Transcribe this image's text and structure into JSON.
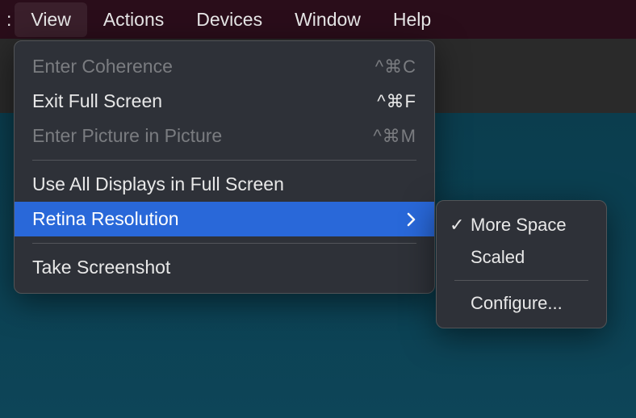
{
  "menubar": {
    "items": [
      {
        "label": "View",
        "selected": true
      },
      {
        "label": "Actions",
        "selected": false
      },
      {
        "label": "Devices",
        "selected": false
      },
      {
        "label": "Window",
        "selected": false
      },
      {
        "label": "Help",
        "selected": false
      }
    ]
  },
  "view_menu": {
    "items": [
      {
        "label": "Enter Coherence",
        "shortcut": "^⌘C",
        "disabled": true
      },
      {
        "label": "Exit Full Screen",
        "shortcut": "^⌘F",
        "disabled": false
      },
      {
        "label": "Enter Picture in Picture",
        "shortcut": "^⌘M",
        "disabled": true
      },
      {
        "label": "Use All Displays in Full Screen",
        "shortcut": "",
        "disabled": false
      },
      {
        "label": "Retina Resolution",
        "shortcut": "",
        "disabled": false,
        "highlighted": true,
        "submenu": true
      },
      {
        "label": "Take Screenshot",
        "shortcut": "",
        "disabled": false
      }
    ]
  },
  "retina_submenu": {
    "items": [
      {
        "label": "More Space",
        "checked": true
      },
      {
        "label": "Scaled",
        "checked": false
      },
      {
        "label": "Configure...",
        "checked": false
      }
    ]
  }
}
